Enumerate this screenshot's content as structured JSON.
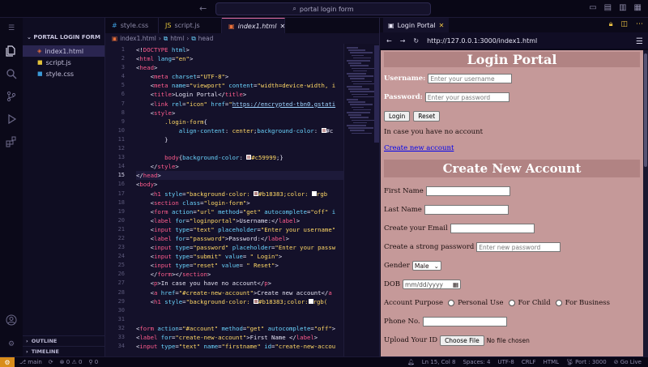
{
  "titlebar": {
    "search": "portal login form",
    "nav": "← →"
  },
  "sidebar": {
    "folder": "PORTAL LOGIN FORM",
    "files": [
      {
        "name": "index1.html",
        "icon": "html-file-icon"
      },
      {
        "name": "script.js",
        "icon": "js-file-icon"
      },
      {
        "name": "style.css",
        "icon": "css-file-icon"
      }
    ],
    "outline": "OUTLINE",
    "timeline": "TIMELINE"
  },
  "editor": {
    "tabs": [
      {
        "label": "style.css"
      },
      {
        "label": "script.js"
      },
      {
        "label": "index1.html",
        "close": "✕"
      }
    ],
    "breadcrumb": [
      "index1.html",
      "html",
      "head"
    ],
    "line_numbers": [
      "1",
      "2",
      "3",
      "4",
      "5",
      "6",
      "7",
      "8",
      "9",
      "10",
      "11",
      "12",
      "13",
      "14",
      "15",
      "16",
      "17",
      "18",
      "19",
      "20",
      "21",
      "22",
      "23",
      "24",
      "25",
      "26",
      "27",
      "28",
      "29",
      "30",
      "31",
      "32",
      "33",
      "34"
    ],
    "current_line": "15"
  },
  "browser": {
    "tab_title": "Login Portal",
    "url": "http://127.0.0.1:3000/index1.html",
    "login": {
      "heading": "Login Portal",
      "username_label": "Username:",
      "username_placeholder": "Enter your username",
      "password_label": "Password:",
      "password_placeholder": "Enter your password",
      "login_button": "Login",
      "reset_button": "Reset",
      "no_account_text": "In case you have no account",
      "create_link": "Create new account"
    },
    "signup": {
      "heading": "Create New Account",
      "first_name": "First Name",
      "last_name": "Last Name",
      "email": "Create your Email",
      "strong_password": "Create a strong password",
      "strong_password_placeholder": "Enter new password",
      "gender": "Gender",
      "gender_value": "Male",
      "dob": "DOB",
      "dob_placeholder": "mm/dd/yyyy",
      "account_purpose": "Account Purpose",
      "purpose_options": [
        "Personal Use",
        "For Child",
        "For Business"
      ],
      "phone": "Phone No.",
      "upload": "Upload Your ID",
      "choose_file": "Choose File",
      "no_file": "No file chosen"
    }
  },
  "statusbar": {
    "branch": "main",
    "sync": "⟳",
    "problems": "⊗ 0 ⚠ 0",
    "ports": "0",
    "position": "Ln 15, Col 8",
    "spaces": "Spaces: 4",
    "encoding": "UTF-8",
    "eol": "CRLF",
    "language": "HTML",
    "port": "Port : 3000",
    "golive": "Go Live"
  },
  "colors": {
    "accent_tab": "#e06c9f",
    "page_bg": "#c59999",
    "banner_bg": "#b18383",
    "status_remote": "#d98d1b"
  }
}
